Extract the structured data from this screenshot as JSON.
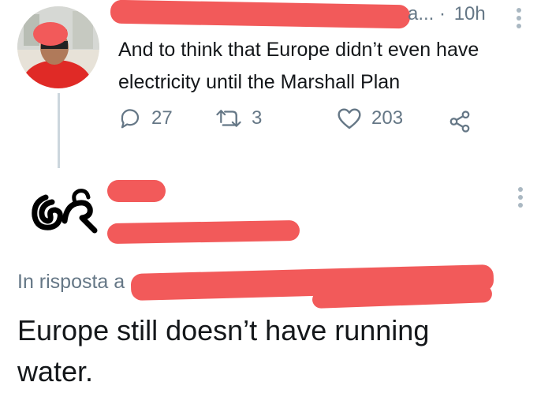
{
  "tweet": {
    "author_redacted": "",
    "handle_tail": "a...",
    "separator": "·",
    "time": "10h",
    "text_line1": "And to think that Europe didn’t even have",
    "text_line2": "electricity until the Marshall Plan",
    "actions": {
      "replies": "27",
      "retweets": "3",
      "likes": "203"
    },
    "icons": [
      "reply-icon",
      "retweet-icon",
      "like-icon",
      "share-icon",
      "more-vertical-icon"
    ]
  },
  "reply": {
    "label_visible": "In risposta a",
    "text_line1": "Europe still doesn’t have running",
    "text_line2": "water."
  },
  "colors": {
    "redaction": "#f25a5a",
    "text_primary": "#14171a",
    "text_secondary": "#657786",
    "thread_line": "#ccd6dd"
  }
}
